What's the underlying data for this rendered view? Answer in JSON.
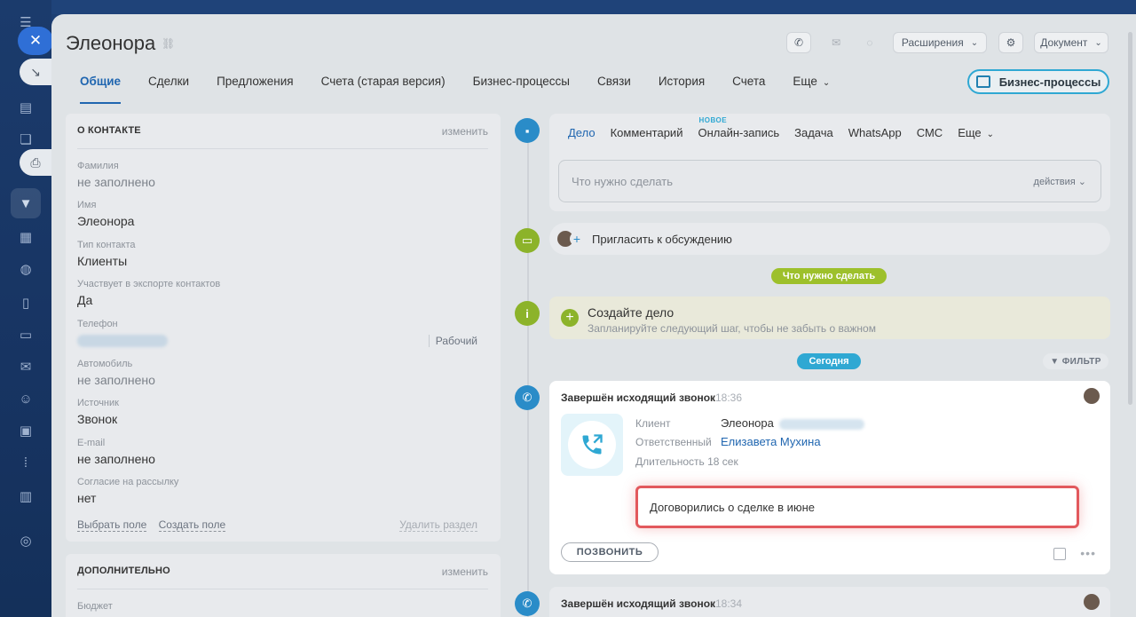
{
  "contact": {
    "name": "Элеонора"
  },
  "toolbar": {
    "extensions_label": "Расширения",
    "document_label": "Документ"
  },
  "tabs": [
    {
      "label": "Общие"
    },
    {
      "label": "Сделки"
    },
    {
      "label": "Предложения"
    },
    {
      "label": "Счета (старая версия)"
    },
    {
      "label": "Бизнес-процессы"
    },
    {
      "label": "Связи"
    },
    {
      "label": "История"
    },
    {
      "label": "Счета"
    },
    {
      "label": "Еще"
    }
  ],
  "bp_button_label": "Бизнес-процессы",
  "about_card": {
    "title": "О КОНТАКТЕ",
    "edit_label": "изменить",
    "fields": [
      {
        "label": "Фамилия",
        "value": "не заполнено"
      },
      {
        "label": "Имя",
        "value": "Элеонора"
      },
      {
        "label": "Тип контакта",
        "value": "Клиенты"
      },
      {
        "label": "Участвует в экспорте контактов",
        "value": "Да"
      },
      {
        "label": "Телефон",
        "value": "",
        "type": "Рабочий"
      },
      {
        "label": "Автомобиль",
        "value": "не заполнено"
      },
      {
        "label": "Источник",
        "value": "Звонок"
      },
      {
        "label": "E-mail",
        "value": "не заполнено"
      },
      {
        "label": "Согласие на рассылку",
        "value": "нет"
      }
    ],
    "select_field": "Выбрать поле",
    "create_field": "Создать поле",
    "delete_section": "Удалить раздел"
  },
  "extra_card": {
    "title": "ДОПОЛНИТЕЛЬНО",
    "edit_label": "изменить",
    "first_field_label": "Бюджет"
  },
  "editor": {
    "tabs": [
      {
        "label": "Дело"
      },
      {
        "label": "Комментарий"
      },
      {
        "label": "Онлайн-запись",
        "badge": "НОВОЕ"
      },
      {
        "label": "Задача"
      },
      {
        "label": "WhatsApp"
      },
      {
        "label": "СМС"
      },
      {
        "label": "Еще"
      }
    ],
    "placeholder": "Что нужно сделать",
    "actions_label": "действия"
  },
  "invite_label": "Пригласить к обсуждению",
  "todo_pill": "Что нужно сделать",
  "todo": {
    "title": "Создайте дело",
    "subtitle": "Запланируйте следующий шаг, чтобы не забыть о важном"
  },
  "today_pill": "Сегодня",
  "filter_label": "ФИЛЬТР",
  "call1": {
    "title": "Завершён исходящий звонок",
    "time": "18:36",
    "client_label": "Клиент",
    "client_value": "Элеонора",
    "responsible_label": "Ответственный",
    "responsible_value": "Елизавета Мухина",
    "duration": "Длительность 18 сек",
    "comment": "Договорились о сделке в июне",
    "call_button": "ПОЗВОНИТЬ"
  },
  "call2": {
    "title": "Завершён исходящий звонок",
    "time": "18:34"
  },
  "colors": {
    "accent": "#2066b0",
    "timeline_blue": "#2a8cc8",
    "timeline_green": "#8cb32a",
    "highlight": "#e2595d"
  }
}
